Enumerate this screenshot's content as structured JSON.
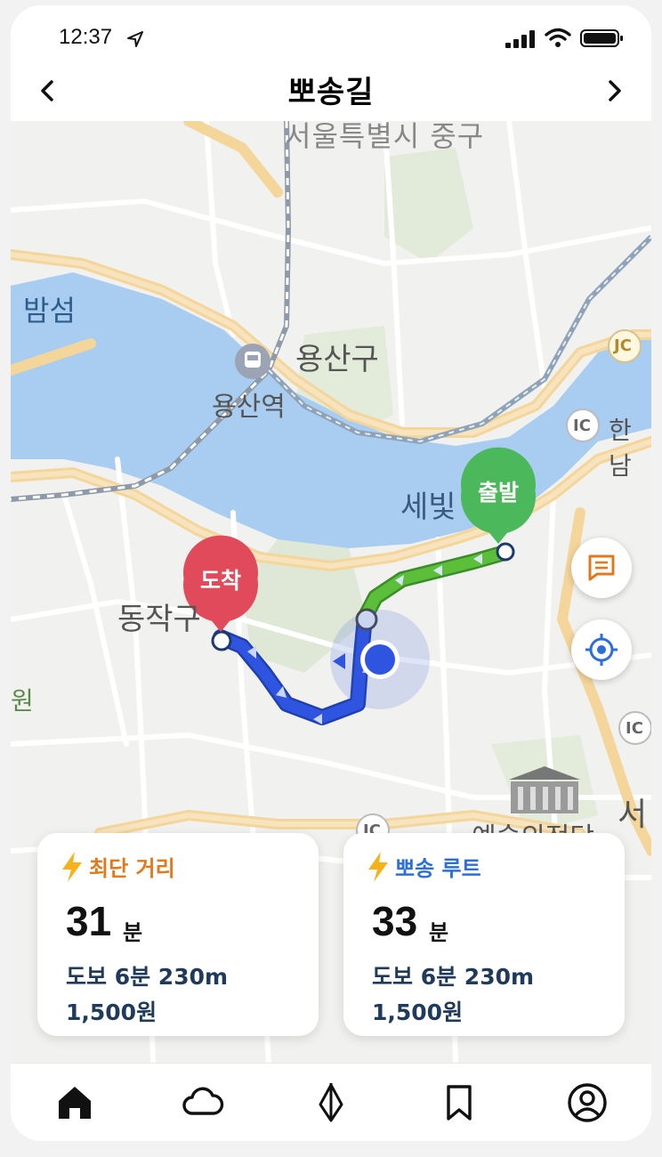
{
  "status": {
    "time": "12:37"
  },
  "header": {
    "title": "뽀송길"
  },
  "map": {
    "labels": {
      "bamseom": "밤섬",
      "yongsan_gu": "용산구",
      "yongsan_station": "용산역",
      "sebit": "세빛",
      "dongjak": "동작구",
      "hannam": "한남",
      "jc": "JC",
      "ic": "IC",
      "won": "원",
      "seo": "서",
      "arts_center": "예술의전당",
      "top_clipped": "서울특별시 중구"
    },
    "markers": {
      "start": "출발",
      "end": "도착"
    },
    "colors": {
      "start": "#4cb85c",
      "end": "#e04a5a",
      "route_green": "#5bbf3a",
      "route_blue": "#2f55e0",
      "river": "#a9cdf0",
      "road_major": "#f6d9a3"
    }
  },
  "cards": [
    {
      "label": "최단 거리",
      "minutes": "31",
      "unit": "분",
      "walk": "도보 6분 230m",
      "fare": "1,500원",
      "color": "#e07a1f"
    },
    {
      "label": "뽀송 루트",
      "minutes": "33",
      "unit": "분",
      "walk": "도보 6분 230m",
      "fare": "1,500원",
      "color": "#2d6fd8"
    }
  ],
  "tabs": [
    "home-icon",
    "cloud-icon",
    "umbrella-icon",
    "bookmark-icon",
    "profile-icon"
  ]
}
